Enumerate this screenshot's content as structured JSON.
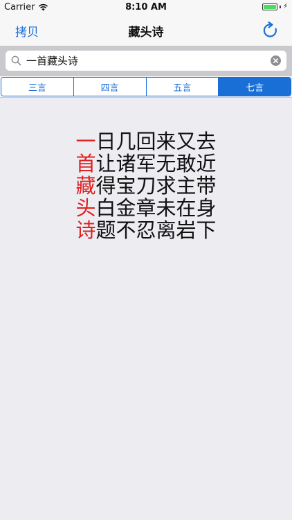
{
  "status_bar": {
    "carrier": "Carrier",
    "time": "8:10 AM"
  },
  "nav": {
    "copy_label": "拷贝",
    "title": "藏头诗",
    "refresh_icon": "refresh-icon"
  },
  "search": {
    "value": "一首藏头诗",
    "placeholder": ""
  },
  "segments": [
    {
      "label": "三言",
      "selected": false
    },
    {
      "label": "四言",
      "selected": false
    },
    {
      "label": "五言",
      "selected": false
    },
    {
      "label": "七言",
      "selected": true
    }
  ],
  "poem": {
    "lines": [
      {
        "head": "一",
        "rest": "日几回来又去"
      },
      {
        "head": "首",
        "rest": "让诸军无敢近"
      },
      {
        "head": "藏",
        "rest": "得宝刀求主带"
      },
      {
        "head": "头",
        "rest": "白金章未在身"
      },
      {
        "head": "诗",
        "rest": "题不忍离岩下"
      }
    ]
  },
  "colors": {
    "accent": "#1a6fd6",
    "head_char": "#e02020",
    "background": "#ececf1"
  }
}
